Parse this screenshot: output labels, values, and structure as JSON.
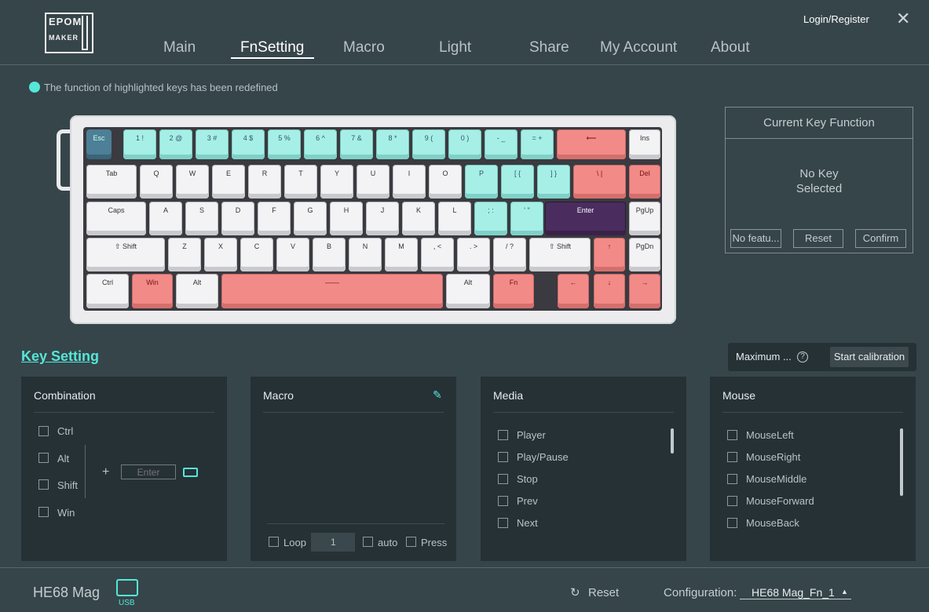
{
  "brand": {
    "line1": "EPOM",
    "line2": "MAKER"
  },
  "nav": {
    "items": [
      "Main",
      "FnSetting",
      "Macro",
      "Light",
      "Share",
      "My Account",
      "About"
    ],
    "active": "FnSetting"
  },
  "header": {
    "login": "Login/Register",
    "close": "✕"
  },
  "legend": {
    "text": "The function of highlighted keys has been redefined",
    "color": "#55e6d9"
  },
  "keyboard": {
    "row1": [
      "Esc",
      "1 !",
      "2 @",
      "3 #",
      "4 $",
      "5 %",
      "6 ^",
      "7 &",
      "8 *",
      "9 (",
      "0 )",
      "- _",
      "= +",
      "⟵",
      "Ins"
    ],
    "row2": [
      "Tab",
      "Q",
      "W",
      "E",
      "R",
      "T",
      "Y",
      "U",
      "I",
      "O",
      "P",
      "[ {",
      "] }",
      "\\ |",
      "Del"
    ],
    "row3": [
      "Caps",
      "A",
      "S",
      "D",
      "F",
      "G",
      "H",
      "J",
      "K",
      "L",
      "; :",
      "' \"",
      "Enter",
      "PgUp"
    ],
    "row4": [
      "⇧ Shift",
      "Z",
      "X",
      "C",
      "V",
      "B",
      "N",
      "M",
      ", <",
      ". >",
      "/ ?",
      "⇧ Shift",
      "↑",
      "PgDn"
    ],
    "row5": [
      "Ctrl",
      "Win",
      "Alt",
      "——",
      "Alt",
      "Fn",
      "←",
      "↓",
      "→"
    ]
  },
  "current_key": {
    "title": "Current Key Function",
    "empty_line1": "No Key",
    "empty_line2": "Selected",
    "btn_feature": "No featu...",
    "btn_reset": "Reset",
    "btn_confirm": "Confirm"
  },
  "key_setting": {
    "title": "Key Setting",
    "calibration_label": "Maximum ...",
    "calibration_help": "?",
    "calibration_button": "Start calibration"
  },
  "combination": {
    "title": "Combination",
    "modifiers": [
      "Ctrl",
      "Alt",
      "Shift",
      "Win"
    ],
    "plus": "+",
    "input_placeholder": "Enter"
  },
  "macro": {
    "title": "Macro",
    "loop_label": "Loop",
    "loop_value": "1",
    "auto_label": "auto",
    "press_label": "Press"
  },
  "media": {
    "title": "Media",
    "items": [
      "Player",
      "Play/Pause",
      "Stop",
      "Prev",
      "Next"
    ]
  },
  "mouse": {
    "title": "Mouse",
    "items": [
      "MouseLeft",
      "MouseRight",
      "MouseMiddle",
      "MouseForward",
      "MouseBack"
    ]
  },
  "footer": {
    "device": "HE68 Mag",
    "connection": "USB",
    "reset": "Reset",
    "config_label": "Configuration:",
    "config_value": "HE68 Mag_Fn_1"
  },
  "colors": {
    "accent": "#55e6d9",
    "remapped": "#a6efe7",
    "fn_layer": "#f28b88",
    "selected": "#4a2d5e"
  }
}
